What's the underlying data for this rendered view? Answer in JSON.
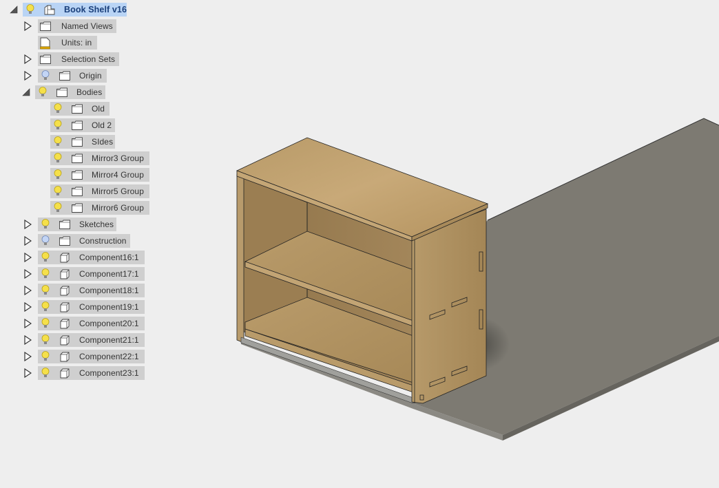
{
  "browser": {
    "root": {
      "label": "Book Shelf v16",
      "expanded": true,
      "visible": true,
      "selected": true,
      "icon": "component-root-icon"
    },
    "items": [
      {
        "label": "Named Views",
        "expander": "collapsed",
        "bulb": null,
        "icon": "folder-icon",
        "level": 1
      },
      {
        "label": "Units: in",
        "expander": null,
        "bulb": null,
        "icon": "units-document-icon",
        "level": 1
      },
      {
        "label": "Selection Sets",
        "expander": "collapsed",
        "bulb": null,
        "icon": "folder-icon",
        "level": 1
      },
      {
        "label": "Origin",
        "expander": "collapsed",
        "bulb": "off",
        "icon": "folder-icon",
        "level": 1
      },
      {
        "label": "Bodies",
        "expander": "expanded",
        "bulb": "on",
        "icon": "folder-icon",
        "level": 1
      },
      {
        "label": "Old",
        "expander": null,
        "bulb": "on",
        "icon": "folder-icon",
        "level": 2
      },
      {
        "label": "Old 2",
        "expander": null,
        "bulb": "on",
        "icon": "folder-icon",
        "level": 2
      },
      {
        "label": "SIdes",
        "expander": null,
        "bulb": "on",
        "icon": "folder-icon",
        "level": 2
      },
      {
        "label": "Mirror3 Group",
        "expander": null,
        "bulb": "on",
        "icon": "folder-icon",
        "level": 2
      },
      {
        "label": "Mirror4 Group",
        "expander": null,
        "bulb": "on",
        "icon": "folder-icon",
        "level": 2
      },
      {
        "label": "Mirror5 Group",
        "expander": null,
        "bulb": "on",
        "icon": "folder-icon",
        "level": 2
      },
      {
        "label": "Mirror6 Group",
        "expander": null,
        "bulb": "on",
        "icon": "folder-icon",
        "level": 2
      },
      {
        "label": "Sketches",
        "expander": "collapsed",
        "bulb": "on",
        "icon": "folder-icon",
        "level": 1
      },
      {
        "label": "Construction",
        "expander": "collapsed",
        "bulb": "off",
        "icon": "folder-icon",
        "level": 1
      },
      {
        "label": "Component16:1",
        "expander": "collapsed",
        "bulb": "on",
        "icon": "component-icon",
        "level": 1
      },
      {
        "label": "Component17:1",
        "expander": "collapsed",
        "bulb": "on",
        "icon": "component-icon",
        "level": 1
      },
      {
        "label": "Component18:1",
        "expander": "collapsed",
        "bulb": "on",
        "icon": "component-icon",
        "level": 1
      },
      {
        "label": "Component19:1",
        "expander": "collapsed",
        "bulb": "on",
        "icon": "component-icon",
        "level": 1
      },
      {
        "label": "Component20:1",
        "expander": "collapsed",
        "bulb": "on",
        "icon": "component-icon",
        "level": 1
      },
      {
        "label": "Component21:1",
        "expander": "collapsed",
        "bulb": "on",
        "icon": "component-icon",
        "level": 1
      },
      {
        "label": "Component22:1",
        "expander": "collapsed",
        "bulb": "on",
        "icon": "component-icon",
        "level": 1
      },
      {
        "label": "Component23:1",
        "expander": "collapsed",
        "bulb": "on",
        "icon": "component-icon",
        "level": 1
      }
    ]
  },
  "viewport": {
    "model": "bookshelf",
    "colors": {
      "background": "#eeeeee",
      "wood_light": "#c7a878",
      "wood_mid": "#b0915f",
      "wood_dark": "#8c7048",
      "ground_plane": "#7d7a72",
      "selection_highlight": "#b9d4f5",
      "row_background": "#cfcfcf",
      "bulb_on": "#f5e04a",
      "bulb_off": "#b8cdf0"
    }
  }
}
